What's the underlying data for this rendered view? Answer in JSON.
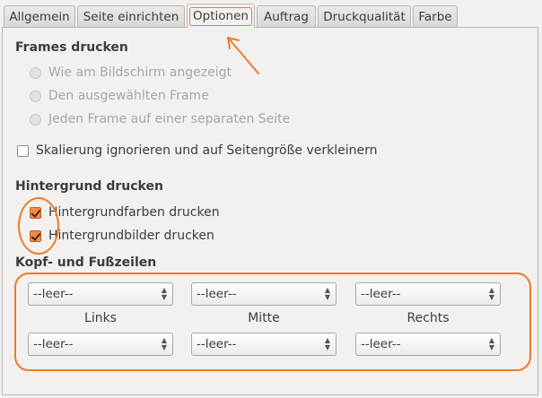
{
  "tabs": [
    {
      "label": "Allgemein",
      "active": false
    },
    {
      "label": "Seite einrichten",
      "active": false
    },
    {
      "label": "Optionen",
      "active": true
    },
    {
      "label": "Auftrag",
      "active": false
    },
    {
      "label": "Druckqualität",
      "active": false
    },
    {
      "label": "Farbe",
      "active": false
    }
  ],
  "frames": {
    "heading": "Frames drucken",
    "options": [
      "Wie am Bildschirm angezeigt",
      "Den ausgewählten Frame",
      "Jeden Frame auf einer separaten Seite"
    ],
    "enabled": false
  },
  "shrink": {
    "label": "Skalierung ignorieren und auf Seitengröße verkleinern",
    "checked": false
  },
  "background": {
    "heading": "Hintergrund drucken",
    "colors": {
      "label": "Hintergrundfarben drucken",
      "checked": true
    },
    "images": {
      "label": "Hintergrundbilder drucken",
      "checked": true
    }
  },
  "headers_footers": {
    "heading": "Kopf- und Fußzeilen",
    "columns": [
      "Links",
      "Mitte",
      "Rechts"
    ],
    "header_values": [
      "--leer--",
      "--leer--",
      "--leer--"
    ],
    "footer_values": [
      "--leer--",
      "--leer--",
      "--leer--"
    ]
  },
  "colors": {
    "annotation": "#f07a2a",
    "checkbox_accent": "#f08b44"
  }
}
